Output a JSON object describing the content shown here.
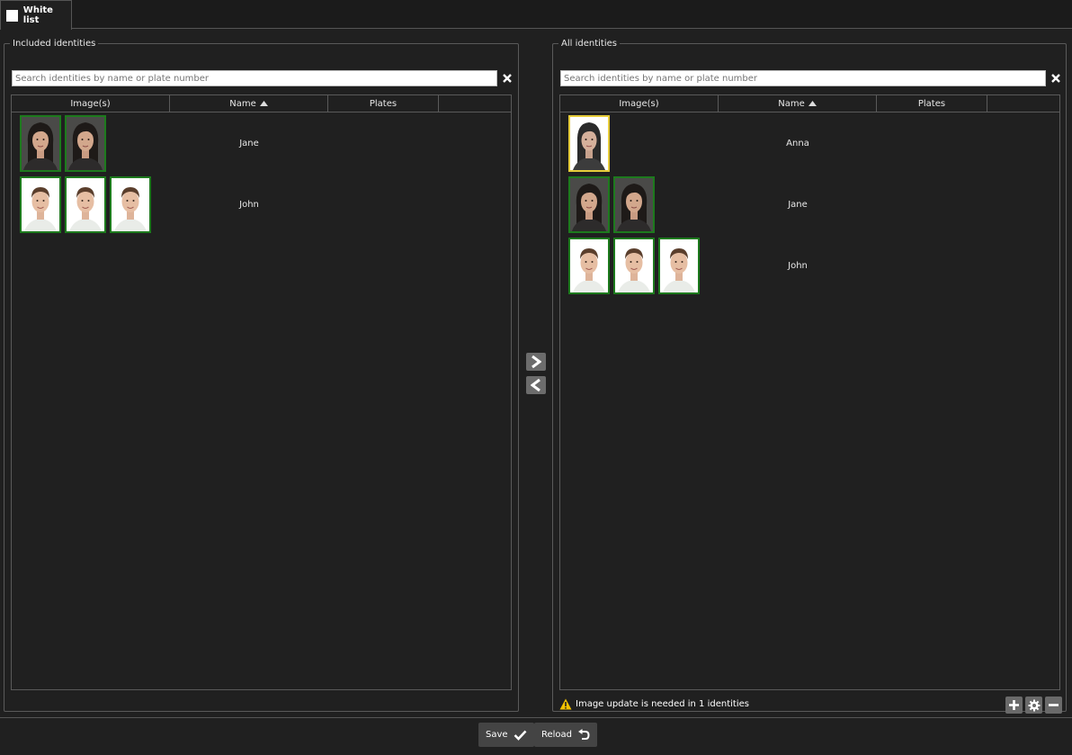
{
  "tab": {
    "label": "White list"
  },
  "included": {
    "legend": "Included identities",
    "search_placeholder": "Search identities by name or plate number",
    "columns": {
      "images": "Image(s)",
      "name": "Name",
      "plates": "Plates"
    },
    "rows": [
      {
        "name": "Jane",
        "images": 2
      },
      {
        "name": "John",
        "images": 3
      }
    ]
  },
  "all": {
    "legend": "All identities",
    "search_placeholder": "Search identities by name or plate number",
    "columns": {
      "images": "Image(s)",
      "name": "Name",
      "plates": "Plates"
    },
    "rows": [
      {
        "name": "Anna",
        "images": 1
      },
      {
        "name": "Jane",
        "images": 2
      },
      {
        "name": "John",
        "images": 3
      }
    ],
    "status": "Image update is needed in 1 identities"
  },
  "footer": {
    "save_label": "Save",
    "reload_label": "Reload"
  },
  "colors": {
    "valid_border": "#1d7a1d",
    "warning_border": "#e6cc3a",
    "warning_icon": "#f2c200"
  }
}
